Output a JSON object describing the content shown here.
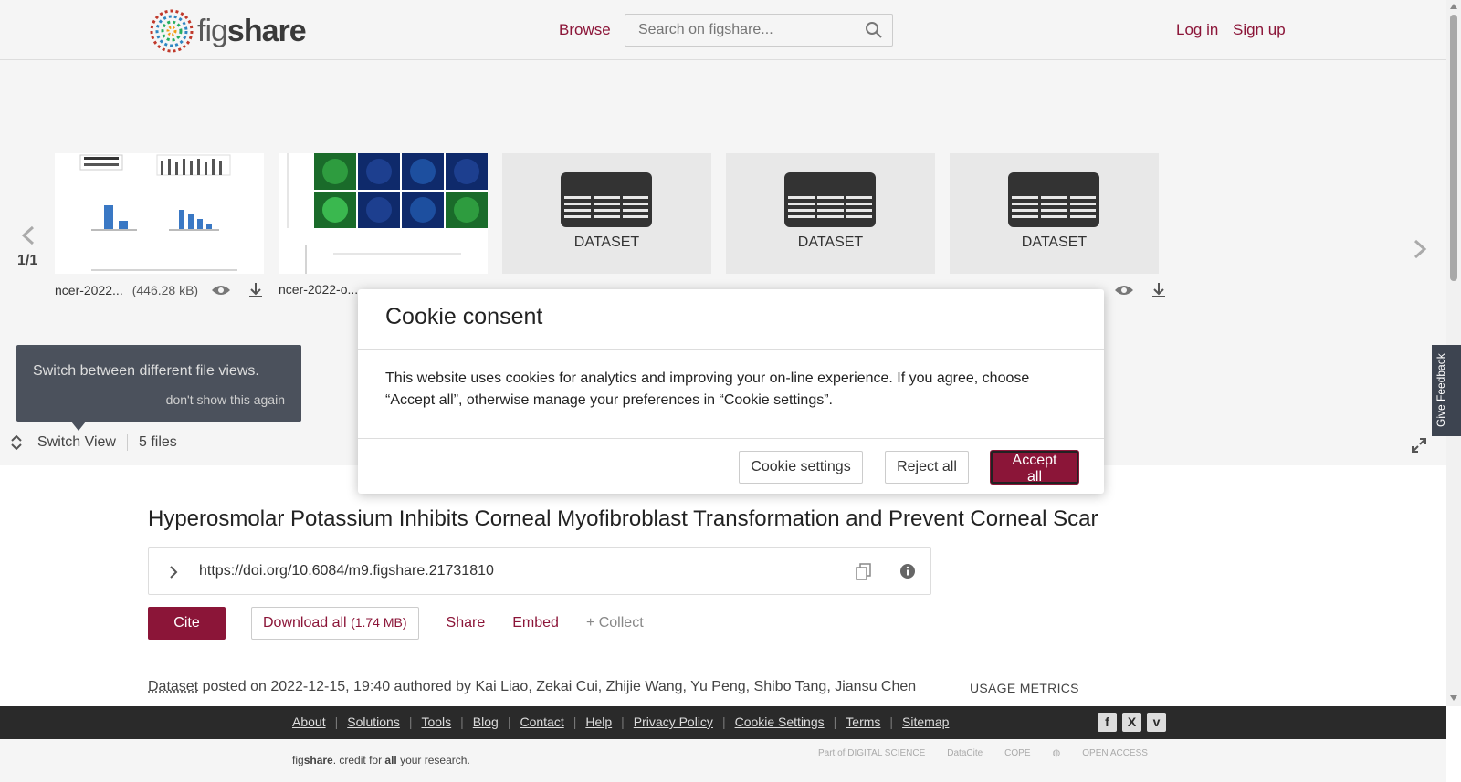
{
  "header": {
    "logo_prefix": "fig",
    "logo_suffix": "share",
    "browse": "Browse",
    "search_placeholder": "Search on figshare...",
    "login": "Log in",
    "signup": "Sign up"
  },
  "viewer": {
    "pager": "1/1",
    "files": [
      {
        "name": "ncer-2022...",
        "size": "(446.28 kB)"
      },
      {
        "name": "ncer-2022-o..."
      }
    ],
    "dataset_label": "DATASET",
    "tooltip_text": "Switch between different file views.",
    "tooltip_dismiss": "don't show this again",
    "switch_view": "Switch View",
    "file_count": "5 files",
    "feedback": "Give Feedback"
  },
  "article": {
    "title": "Hyperosmolar Potassium Inhibits Corneal Myofibroblast Transformation and Prevent Corneal Scar",
    "doi": "https://doi.org/10.6084/m9.figshare.21731810",
    "cite": "Cite",
    "download": "Download all",
    "download_size": "(1.74 MB)",
    "share": "Share",
    "embed": "Embed",
    "collect": "+ Collect",
    "type": "Dataset",
    "posted_text": "posted on 2022-12-15, 19:40 authored by Kai Liao, Zekai Cui, Zhijie Wang, Yu Peng, Shibo Tang, Jiansu Chen",
    "usage": "USAGE METRICS"
  },
  "footer": {
    "links": [
      "About",
      "Solutions",
      "Tools",
      "Blog",
      "Contact",
      "Help",
      "Privacy Policy",
      "Cookie Settings",
      "Terms",
      "Sitemap"
    ],
    "social": [
      "f",
      "X",
      "v"
    ],
    "tagline_pre": "fig",
    "tagline_bold": "share",
    "tagline_mid": ". credit for ",
    "tagline_all": "all",
    "tagline_post": " your research.",
    "partners": [
      "Part of DIGITAL SCIENCE",
      "DataCite",
      "COPE",
      "",
      "OPEN ACCESS"
    ]
  },
  "cookie": {
    "title": "Cookie consent",
    "body": "This website uses cookies for analytics and improving your on-line experience. If you agree, choose “Accept all”, otherwise manage your preferences in “Cookie settings”.",
    "settings": "Cookie settings",
    "reject": "Reject all",
    "accept": "Accept all"
  },
  "colors": {
    "brand": "#8b1538",
    "footer": "#2a2a2a",
    "tooltip": "#3d4450"
  }
}
